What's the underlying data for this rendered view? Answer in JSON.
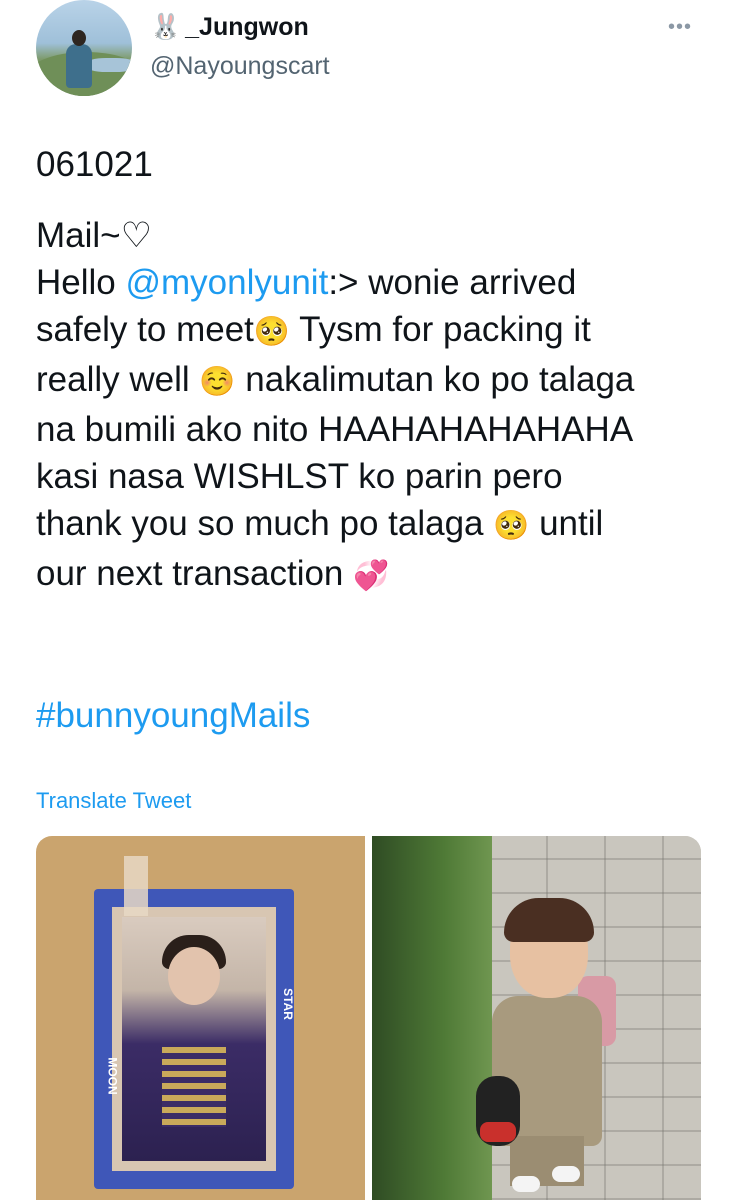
{
  "header": {
    "name_emoji": "🐰",
    "display_name": "_Jungwon",
    "handle": "@Nayoungscart",
    "more_icon": "•••"
  },
  "tweet": {
    "date_line": "061021",
    "lines": [
      {
        "text": "Mail~♡"
      },
      {
        "pre": "Hello ",
        "mention": "@myonlyunit",
        "post": ":> wonie arrived"
      },
      {
        "pre": "safely to meet",
        "emoji": "🥺",
        "post": " Tysm for packing it"
      },
      {
        "pre": "really well ",
        "emoji": "☺️",
        "post": " nakalimutan ko po talaga"
      },
      {
        "text": "na bumili ako nito HAAHAHAHAHAHA"
      },
      {
        "text": "kasi nasa WISHLST ko parin pero"
      },
      {
        "pre": "thank you so much po talaga ",
        "emoji": "🥺",
        "post": " until"
      },
      {
        "pre": "our next transaction ",
        "emoji": "💞",
        "post": ""
      }
    ],
    "hashtag": "#bunnyoungMails",
    "translate_label": "Translate Tweet"
  },
  "media": {
    "left_image_text": [
      "STAR",
      "MOON"
    ],
    "left_image_alt": "photocard in blue frame",
    "right_image_alt": "child with backpack"
  },
  "colors": {
    "link": "#1d9bf0",
    "text": "#0f1419",
    "secondary": "#536471"
  }
}
